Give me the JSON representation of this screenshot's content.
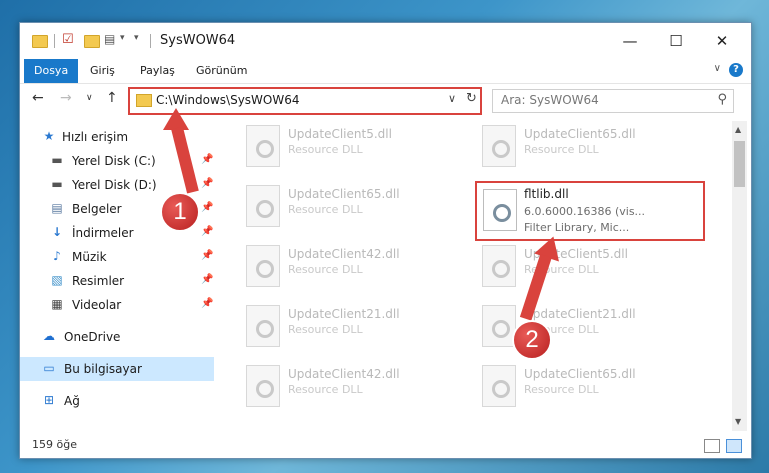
{
  "window": {
    "title": "SysWOW64"
  },
  "title_buttons": {
    "minimize": "—",
    "maximize": "☐",
    "close": "✕"
  },
  "ribbon": {
    "tabs": [
      "Dosya",
      "Giriş",
      "Paylaş",
      "Görünüm"
    ],
    "help": "?"
  },
  "nav": {
    "address": "C:\\Windows\\SysWOW64",
    "search_placeholder": "Ara: SysWOW64"
  },
  "sidebar": {
    "items": [
      {
        "label": "Hızlı erişim",
        "icon": "star-icon"
      },
      {
        "label": "Yerel Disk (C:)",
        "icon": "drive-icon"
      },
      {
        "label": "Yerel Disk (D:)",
        "icon": "drive-icon"
      },
      {
        "label": "Belgeler",
        "icon": "documents-icon"
      },
      {
        "label": "İndirmeler",
        "icon": "download-icon"
      },
      {
        "label": "Müzik",
        "icon": "music-icon"
      },
      {
        "label": "Resimler",
        "icon": "pictures-icon"
      },
      {
        "label": "Videolar",
        "icon": "video-icon"
      },
      {
        "label": "OneDrive",
        "icon": "cloud-icon"
      },
      {
        "label": "Bu bilgisayar",
        "icon": "computer-icon"
      },
      {
        "label": "Ağ",
        "icon": "network-icon"
      }
    ]
  },
  "files": [
    {
      "name": "UpdateClient5.dll",
      "desc": "Resource DLL"
    },
    {
      "name": "UpdateClient65.dll",
      "desc": "Resource DLL"
    },
    {
      "name": "UpdateClient65.dll",
      "desc": "Resource DLL"
    },
    {
      "name": "UpdateClient42.dll",
      "desc": "Resource DLL"
    },
    {
      "name": "UpdateClient5.dll",
      "desc": "Resource DLL"
    },
    {
      "name": "UpdateClient21.dll",
      "desc": "Resource DLL"
    },
    {
      "name": "UpdateClient21.dll",
      "desc": "Resource DLL"
    },
    {
      "name": "UpdateClient42.dll",
      "desc": "Resource DLL"
    },
    {
      "name": "UpdateClient65.dll",
      "desc": "Resource DLL"
    }
  ],
  "focused_file": {
    "name": "fltlib.dll",
    "version": "6.0.6000.16386 (vis...",
    "desc": "Filter Library, Mic..."
  },
  "status": {
    "count": "159 öğe"
  },
  "annotations": {
    "badge1": "1",
    "badge2": "2",
    "accent": "#d9433d"
  }
}
